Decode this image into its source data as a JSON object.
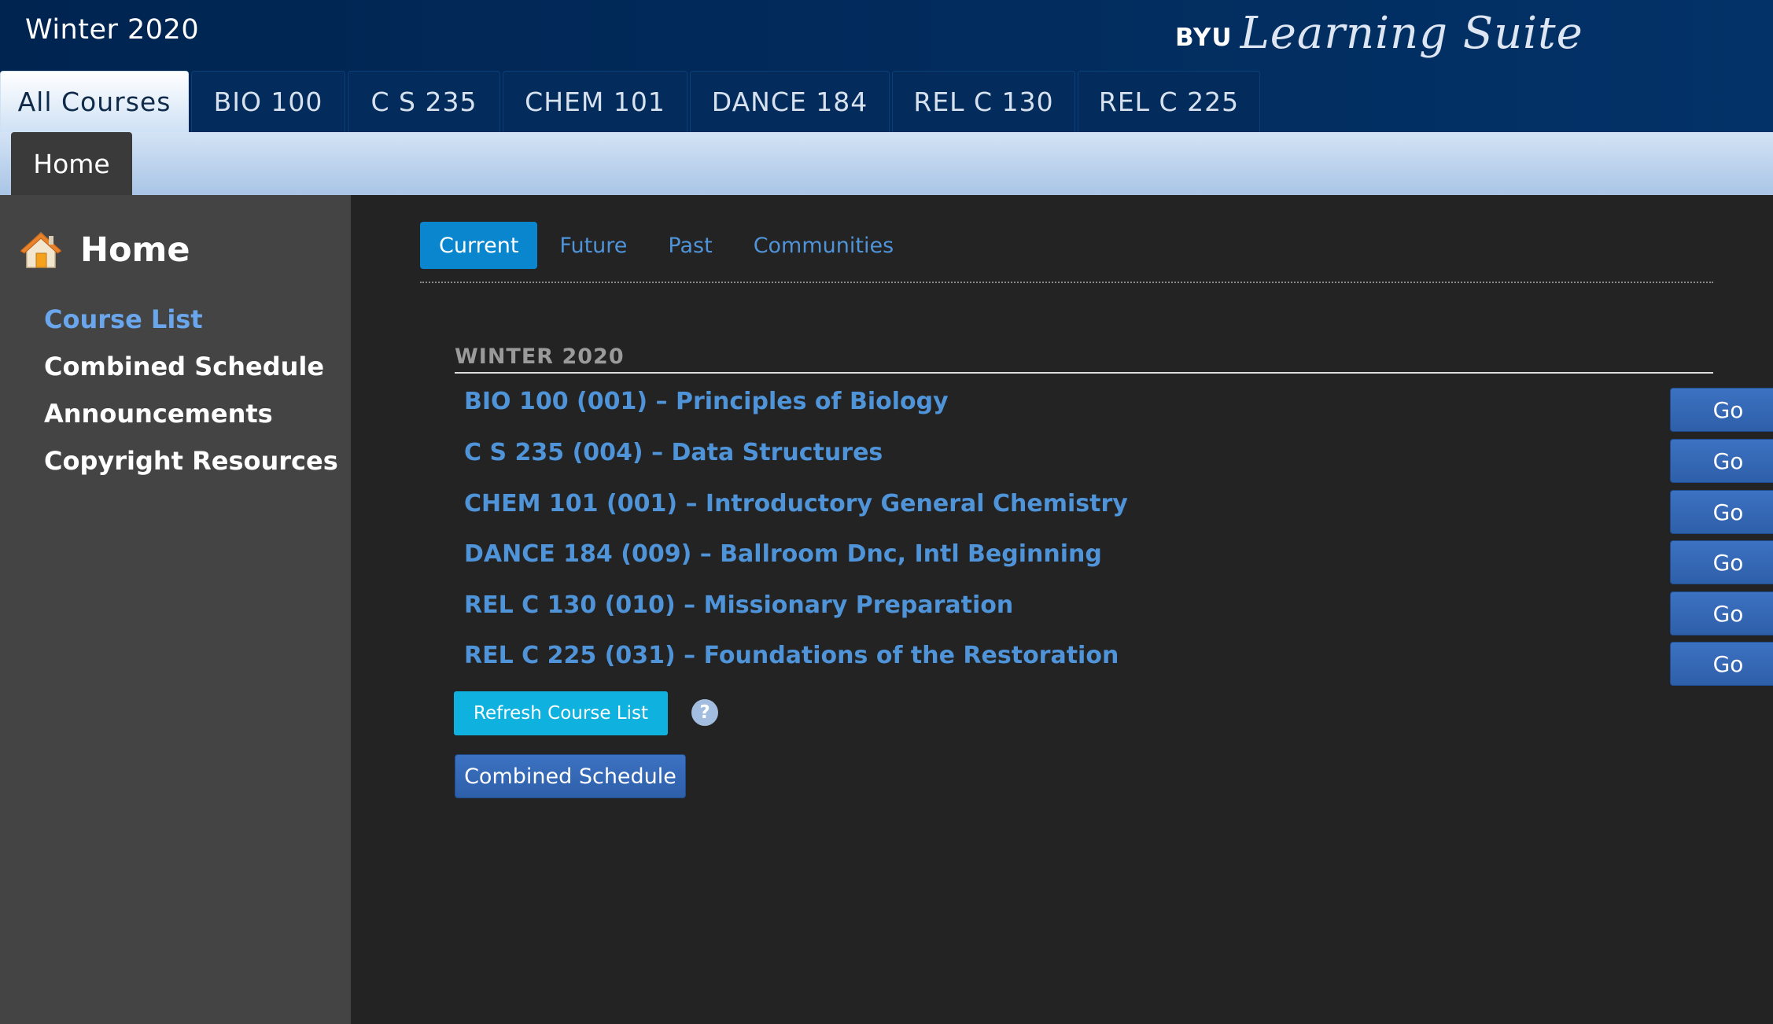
{
  "header": {
    "semester": "Winter 2020",
    "brand_byu": "BYU",
    "brand_suite": "Learning Suite"
  },
  "course_tabs": [
    {
      "label": "All Courses",
      "active": true
    },
    {
      "label": "BIO  100"
    },
    {
      "label": "C S  235"
    },
    {
      "label": "CHEM  101"
    },
    {
      "label": "DANCE  184"
    },
    {
      "label": "REL C  130"
    },
    {
      "label": "REL C  225"
    }
  ],
  "subnav": {
    "home_label": "Home"
  },
  "sidebar": {
    "title": "Home",
    "icon": "home-icon",
    "links": [
      {
        "label": "Course List",
        "active": true
      },
      {
        "label": "Combined Schedule"
      },
      {
        "label": "Announcements"
      },
      {
        "label": "Copyright Resources"
      }
    ]
  },
  "main": {
    "filter_tabs": [
      {
        "label": "Current",
        "active": true
      },
      {
        "label": "Future"
      },
      {
        "label": "Past"
      },
      {
        "label": "Communities"
      }
    ],
    "term_heading": "WINTER 2020",
    "courses": [
      {
        "title": "BIO 100 (001) – Principles of Biology",
        "button": "Go"
      },
      {
        "title": "C S 235 (004) – Data Structures",
        "button": "Go"
      },
      {
        "title": "CHEM 101 (001) – Introductory General Chemistry",
        "button": "Go"
      },
      {
        "title": "DANCE 184 (009) – Ballroom Dnc, Intl Beginning",
        "button": "Go"
      },
      {
        "title": "REL C 130 (010) – Missionary Preparation",
        "button": "Go"
      },
      {
        "title": "REL C 225 (031) – Foundations of the Restoration",
        "button": "Go"
      }
    ],
    "refresh_label": "Refresh Course List",
    "help_symbol": "?",
    "combined_label": "Combined Schedule"
  },
  "colors": {
    "header_bg": "#00264f",
    "accent_link": "#4f93d8",
    "active_filter": "#0a86cf",
    "go_button": "#3466b4",
    "refresh_button": "#0fb2df"
  }
}
